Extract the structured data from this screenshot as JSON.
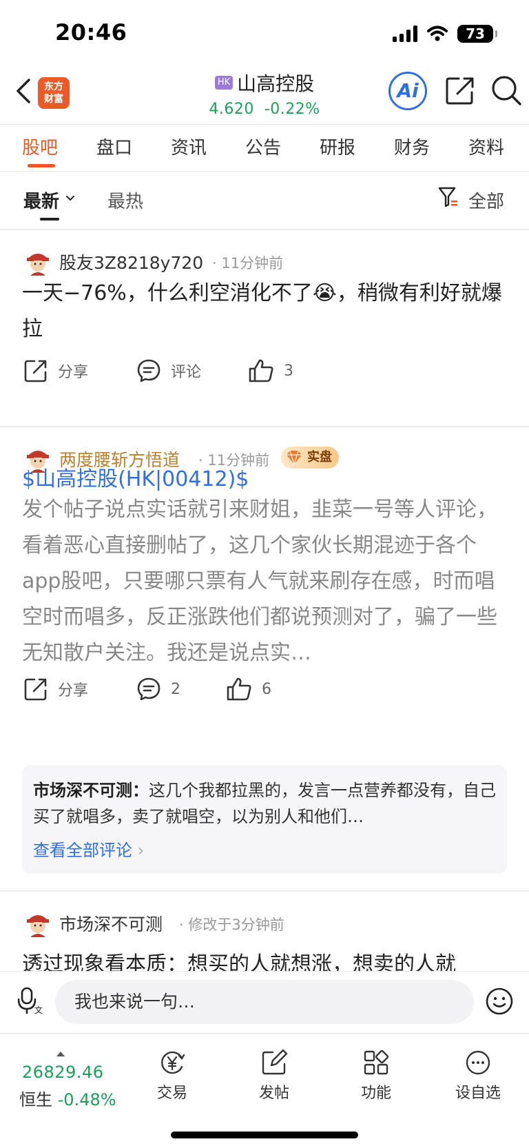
{
  "status_bar": {
    "time": "20:46",
    "battery": "73"
  },
  "header": {
    "app_logo_line1": "东方",
    "app_logo_line2": "财富",
    "market_badge": "HK",
    "stock_name": "山高控股",
    "price": "4.620",
    "change_pct": "-0.22%",
    "ai_label": "Ai"
  },
  "tabs": [
    "股吧",
    "盘口",
    "资讯",
    "公告",
    "研报",
    "财务",
    "资料"
  ],
  "sort": {
    "latest": "最新",
    "hot": "最热",
    "filter_label": "全部"
  },
  "posts": [
    {
      "author": "股友3Z8218y720",
      "time": "· 11分钟前",
      "text_before_emoji": "一天−76%，什么利空消化不了",
      "emoji": "😭",
      "text_after_emoji": "，稍微有利好就爆拉",
      "share_label": "分享",
      "comment_label": "评论",
      "like_count": "3"
    },
    {
      "author": "两度腰斩方悟道",
      "time": "· 11分钟前",
      "badge": "实盘",
      "stock_link": "$山高控股(HK|00412)$",
      "text": "发个帖子说点实话就引来财姐，韭菜一号等人评论，看着恶心直接删帖了，这几个家伙长期混迹于各个app股吧，只要哪只票有人气就来刷存在感，时而唱空时而唱多，反正涨跌他们都说预测对了，骗了一些无知散户关注。我还是说点实…",
      "share_label": "分享",
      "comment_count": "2",
      "like_count": "6",
      "top_comment_author": "市场深不可测：",
      "top_comment_text": "这几个我都拉黑的，发言一点营养都没有，自己买了就唱多，卖了就唱空，以为别人和他们…",
      "view_all_label": "查看全部评论"
    },
    {
      "author": "市场深不可测",
      "time": "· 修改于3分钟前",
      "text": "透过现象看本质：想买的人就想涨，想卖的人就"
    }
  ],
  "input": {
    "placeholder": "我也来说一句…"
  },
  "bottom_bar": {
    "index_value": "26829.46",
    "index_name": "恒生",
    "index_change": "-0.48%",
    "nav": [
      "交易",
      "发帖",
      "功能",
      "设自选"
    ]
  },
  "colors": {
    "accent": "#ea5a24",
    "down_green": "#1aa05a",
    "link_blue": "#2f6fe0"
  }
}
